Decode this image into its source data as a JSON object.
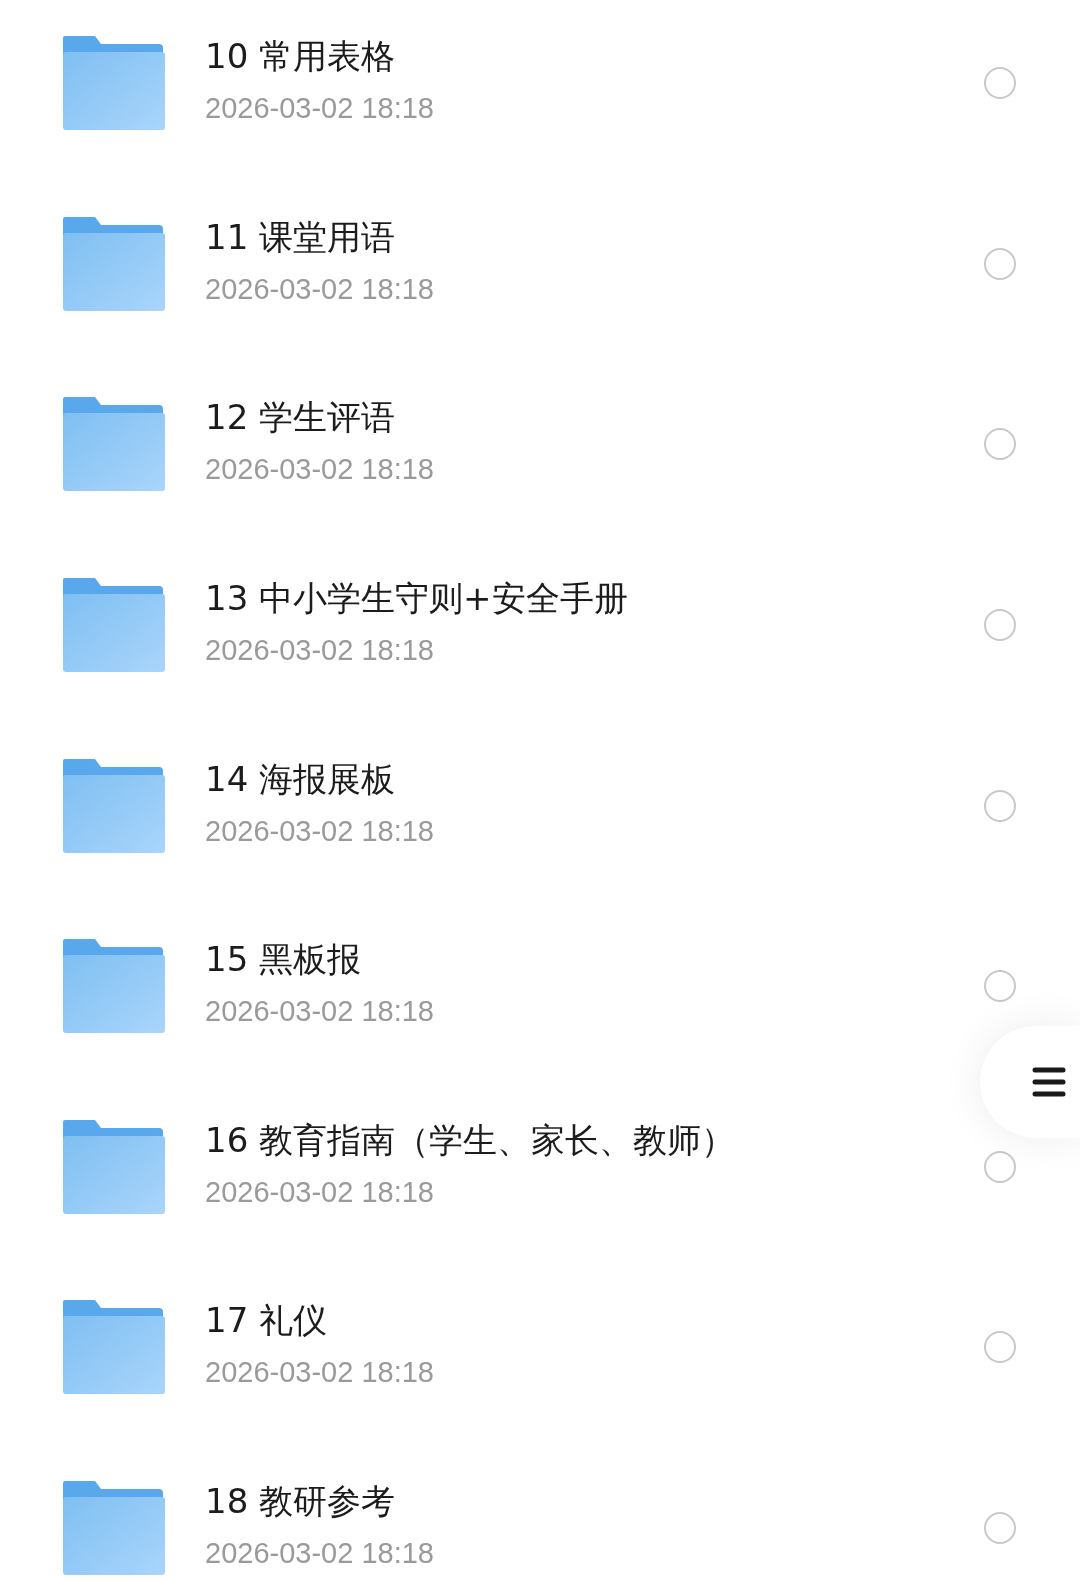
{
  "folders": [
    {
      "name": "10 常用表格",
      "date": "2026-03-02 18:18",
      "selected": false
    },
    {
      "name": "11 课堂用语",
      "date": "2026-03-02 18:18",
      "selected": false
    },
    {
      "name": "12 学生评语",
      "date": "2026-03-02 18:18",
      "selected": false
    },
    {
      "name": "13 中小学生守则+安全手册",
      "date": "2026-03-02 18:18",
      "selected": false
    },
    {
      "name": "14 海报展板",
      "date": "2026-03-02 18:18",
      "selected": false
    },
    {
      "name": "15 黑板报",
      "date": "2026-03-02 18:18",
      "selected": false
    },
    {
      "name": "16 教育指南（学生、家长、教师）",
      "date": "2026-03-02 18:18",
      "selected": false
    },
    {
      "name": "17 礼仪",
      "date": "2026-03-02 18:18",
      "selected": false
    },
    {
      "name": "18 教研参考",
      "date": "2026-03-02 18:18",
      "selected": false
    }
  ]
}
